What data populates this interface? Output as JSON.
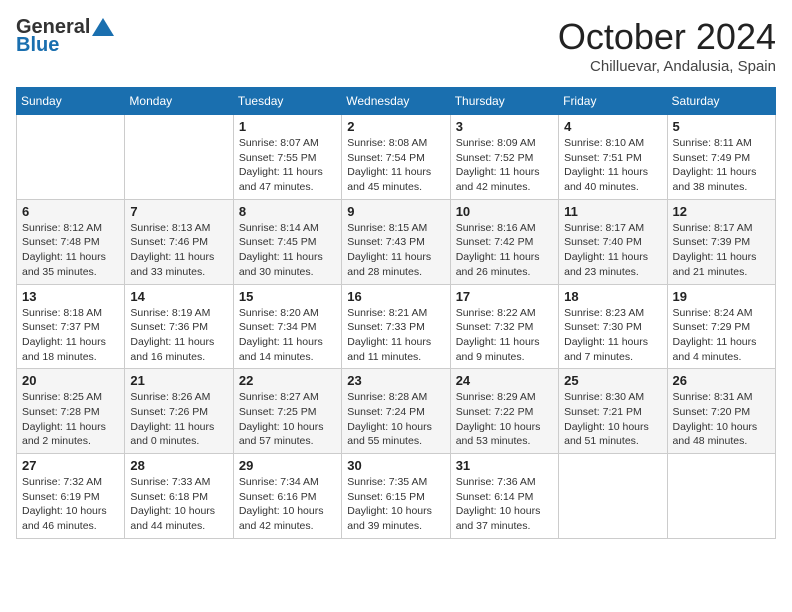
{
  "header": {
    "logo_general": "General",
    "logo_blue": "Blue",
    "month_title": "October 2024",
    "location": "Chilluevar, Andalusia, Spain"
  },
  "days_of_week": [
    "Sunday",
    "Monday",
    "Tuesday",
    "Wednesday",
    "Thursday",
    "Friday",
    "Saturday"
  ],
  "weeks": [
    [
      {
        "day": "",
        "sunrise": "",
        "sunset": "",
        "daylight": ""
      },
      {
        "day": "",
        "sunrise": "",
        "sunset": "",
        "daylight": ""
      },
      {
        "day": "1",
        "sunrise": "Sunrise: 8:07 AM",
        "sunset": "Sunset: 7:55 PM",
        "daylight": "Daylight: 11 hours and 47 minutes."
      },
      {
        "day": "2",
        "sunrise": "Sunrise: 8:08 AM",
        "sunset": "Sunset: 7:54 PM",
        "daylight": "Daylight: 11 hours and 45 minutes."
      },
      {
        "day": "3",
        "sunrise": "Sunrise: 8:09 AM",
        "sunset": "Sunset: 7:52 PM",
        "daylight": "Daylight: 11 hours and 42 minutes."
      },
      {
        "day": "4",
        "sunrise": "Sunrise: 8:10 AM",
        "sunset": "Sunset: 7:51 PM",
        "daylight": "Daylight: 11 hours and 40 minutes."
      },
      {
        "day": "5",
        "sunrise": "Sunrise: 8:11 AM",
        "sunset": "Sunset: 7:49 PM",
        "daylight": "Daylight: 11 hours and 38 minutes."
      }
    ],
    [
      {
        "day": "6",
        "sunrise": "Sunrise: 8:12 AM",
        "sunset": "Sunset: 7:48 PM",
        "daylight": "Daylight: 11 hours and 35 minutes."
      },
      {
        "day": "7",
        "sunrise": "Sunrise: 8:13 AM",
        "sunset": "Sunset: 7:46 PM",
        "daylight": "Daylight: 11 hours and 33 minutes."
      },
      {
        "day": "8",
        "sunrise": "Sunrise: 8:14 AM",
        "sunset": "Sunset: 7:45 PM",
        "daylight": "Daylight: 11 hours and 30 minutes."
      },
      {
        "day": "9",
        "sunrise": "Sunrise: 8:15 AM",
        "sunset": "Sunset: 7:43 PM",
        "daylight": "Daylight: 11 hours and 28 minutes."
      },
      {
        "day": "10",
        "sunrise": "Sunrise: 8:16 AM",
        "sunset": "Sunset: 7:42 PM",
        "daylight": "Daylight: 11 hours and 26 minutes."
      },
      {
        "day": "11",
        "sunrise": "Sunrise: 8:17 AM",
        "sunset": "Sunset: 7:40 PM",
        "daylight": "Daylight: 11 hours and 23 minutes."
      },
      {
        "day": "12",
        "sunrise": "Sunrise: 8:17 AM",
        "sunset": "Sunset: 7:39 PM",
        "daylight": "Daylight: 11 hours and 21 minutes."
      }
    ],
    [
      {
        "day": "13",
        "sunrise": "Sunrise: 8:18 AM",
        "sunset": "Sunset: 7:37 PM",
        "daylight": "Daylight: 11 hours and 18 minutes."
      },
      {
        "day": "14",
        "sunrise": "Sunrise: 8:19 AM",
        "sunset": "Sunset: 7:36 PM",
        "daylight": "Daylight: 11 hours and 16 minutes."
      },
      {
        "day": "15",
        "sunrise": "Sunrise: 8:20 AM",
        "sunset": "Sunset: 7:34 PM",
        "daylight": "Daylight: 11 hours and 14 minutes."
      },
      {
        "day": "16",
        "sunrise": "Sunrise: 8:21 AM",
        "sunset": "Sunset: 7:33 PM",
        "daylight": "Daylight: 11 hours and 11 minutes."
      },
      {
        "day": "17",
        "sunrise": "Sunrise: 8:22 AM",
        "sunset": "Sunset: 7:32 PM",
        "daylight": "Daylight: 11 hours and 9 minutes."
      },
      {
        "day": "18",
        "sunrise": "Sunrise: 8:23 AM",
        "sunset": "Sunset: 7:30 PM",
        "daylight": "Daylight: 11 hours and 7 minutes."
      },
      {
        "day": "19",
        "sunrise": "Sunrise: 8:24 AM",
        "sunset": "Sunset: 7:29 PM",
        "daylight": "Daylight: 11 hours and 4 minutes."
      }
    ],
    [
      {
        "day": "20",
        "sunrise": "Sunrise: 8:25 AM",
        "sunset": "Sunset: 7:28 PM",
        "daylight": "Daylight: 11 hours and 2 minutes."
      },
      {
        "day": "21",
        "sunrise": "Sunrise: 8:26 AM",
        "sunset": "Sunset: 7:26 PM",
        "daylight": "Daylight: 11 hours and 0 minutes."
      },
      {
        "day": "22",
        "sunrise": "Sunrise: 8:27 AM",
        "sunset": "Sunset: 7:25 PM",
        "daylight": "Daylight: 10 hours and 57 minutes."
      },
      {
        "day": "23",
        "sunrise": "Sunrise: 8:28 AM",
        "sunset": "Sunset: 7:24 PM",
        "daylight": "Daylight: 10 hours and 55 minutes."
      },
      {
        "day": "24",
        "sunrise": "Sunrise: 8:29 AM",
        "sunset": "Sunset: 7:22 PM",
        "daylight": "Daylight: 10 hours and 53 minutes."
      },
      {
        "day": "25",
        "sunrise": "Sunrise: 8:30 AM",
        "sunset": "Sunset: 7:21 PM",
        "daylight": "Daylight: 10 hours and 51 minutes."
      },
      {
        "day": "26",
        "sunrise": "Sunrise: 8:31 AM",
        "sunset": "Sunset: 7:20 PM",
        "daylight": "Daylight: 10 hours and 48 minutes."
      }
    ],
    [
      {
        "day": "27",
        "sunrise": "Sunrise: 7:32 AM",
        "sunset": "Sunset: 6:19 PM",
        "daylight": "Daylight: 10 hours and 46 minutes."
      },
      {
        "day": "28",
        "sunrise": "Sunrise: 7:33 AM",
        "sunset": "Sunset: 6:18 PM",
        "daylight": "Daylight: 10 hours and 44 minutes."
      },
      {
        "day": "29",
        "sunrise": "Sunrise: 7:34 AM",
        "sunset": "Sunset: 6:16 PM",
        "daylight": "Daylight: 10 hours and 42 minutes."
      },
      {
        "day": "30",
        "sunrise": "Sunrise: 7:35 AM",
        "sunset": "Sunset: 6:15 PM",
        "daylight": "Daylight: 10 hours and 39 minutes."
      },
      {
        "day": "31",
        "sunrise": "Sunrise: 7:36 AM",
        "sunset": "Sunset: 6:14 PM",
        "daylight": "Daylight: 10 hours and 37 minutes."
      },
      {
        "day": "",
        "sunrise": "",
        "sunset": "",
        "daylight": ""
      },
      {
        "day": "",
        "sunrise": "",
        "sunset": "",
        "daylight": ""
      }
    ]
  ]
}
